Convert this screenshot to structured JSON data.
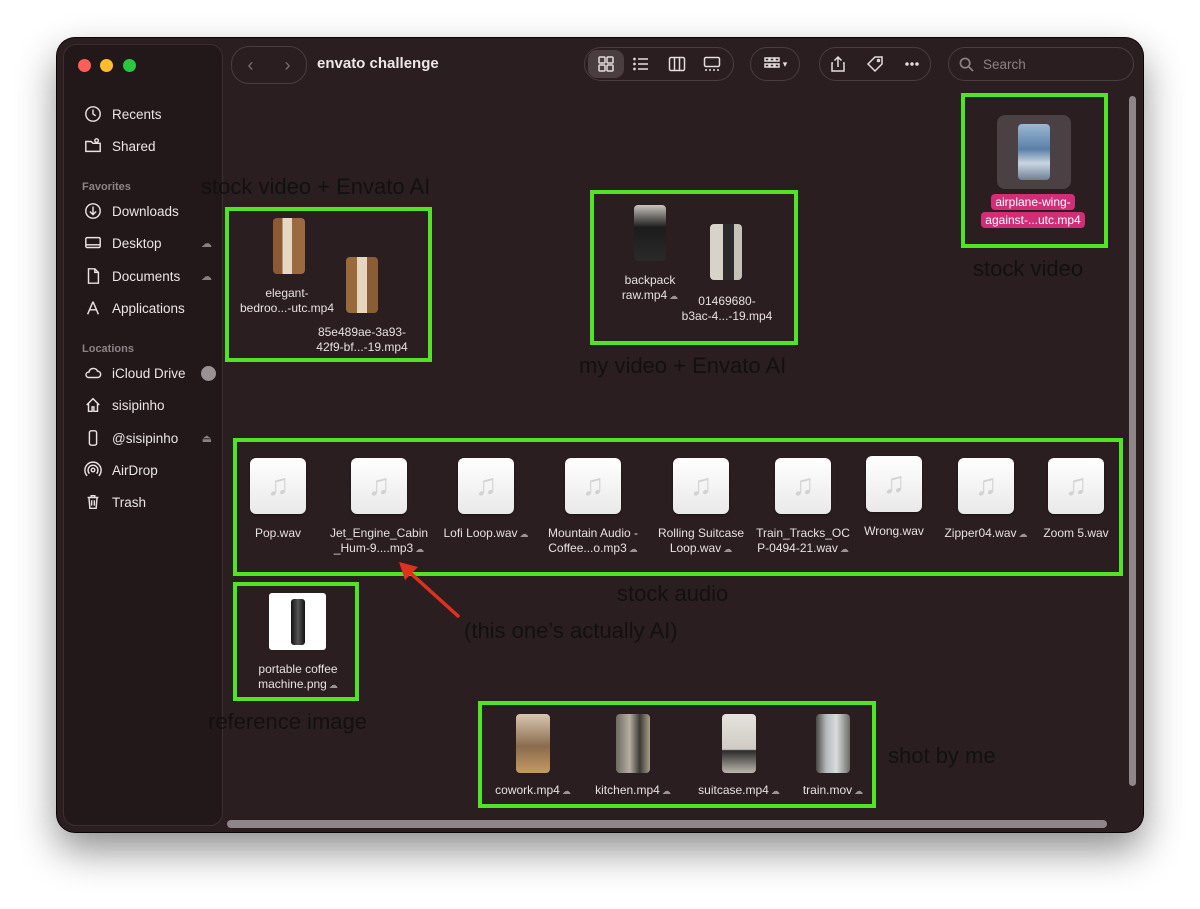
{
  "window": {
    "title": "envato challenge"
  },
  "sidebar": {
    "items_top": [
      {
        "label": "Recents",
        "icon": "clock-icon"
      },
      {
        "label": "Shared",
        "icon": "shared-folder-icon"
      }
    ],
    "favorites_header": "Favorites",
    "favorites": [
      {
        "label": "Downloads",
        "icon": "download-icon"
      },
      {
        "label": "Desktop",
        "icon": "desktop-icon"
      },
      {
        "label": "Documents",
        "icon": "document-icon"
      },
      {
        "label": "Applications",
        "icon": "applications-icon"
      }
    ],
    "locations_header": "Locations",
    "locations": [
      {
        "label": "iCloud Drive",
        "icon": "cloud-icon"
      },
      {
        "label": "sisipinho",
        "icon": "home-icon"
      },
      {
        "label": "@sisipinho",
        "icon": "phone-icon"
      },
      {
        "label": "AirDrop",
        "icon": "airdrop-icon"
      },
      {
        "label": "Trash",
        "icon": "trash-icon"
      }
    ]
  },
  "toolbar": {
    "search_placeholder": "Search"
  },
  "files": {
    "stock_ai": [
      {
        "name_line1": "elegant-",
        "name_line2": "bedroo...-utc.mp4"
      },
      {
        "name_line1": "85e489ae-3a93-",
        "name_line2": "42f9-bf...-19.mp4"
      }
    ],
    "my_ai": [
      {
        "name_line1": "backpack",
        "name_line2": "raw.mp4"
      },
      {
        "name_line1": "01469680-",
        "name_line2": "b3ac-4...-19.mp4"
      }
    ],
    "stock_video": {
      "name_line1": "airplane-wing-",
      "name_line2": "against-...utc.mp4"
    },
    "audio": [
      {
        "line1": "Pop.wav",
        "line2": ""
      },
      {
        "line1": "Jet_Engine_Cabin",
        "line2": "_Hum-9....mp3"
      },
      {
        "line1": "Lofi Loop.wav",
        "line2": ""
      },
      {
        "line1": "Mountain Audio -",
        "line2": "Coffee...o.mp3"
      },
      {
        "line1": "Rolling Suitcase",
        "line2": "Loop.wav"
      },
      {
        "line1": "Train_Tracks_OC",
        "line2": "P-0494-21.wav"
      },
      {
        "line1": "Wrong.wav",
        "line2": ""
      },
      {
        "line1": "Zipper04.wav",
        "line2": ""
      },
      {
        "line1": "Zoom 5.wav",
        "line2": ""
      }
    ],
    "reference": {
      "name_line1": "portable coffee",
      "name_line2": "machine.png"
    },
    "shot": [
      {
        "name": "cowork.mp4"
      },
      {
        "name": "kitchen.mp4"
      },
      {
        "name": "suitcase.mp4"
      },
      {
        "name": "train.mov"
      }
    ]
  },
  "annotations": {
    "stock_ai": "stock video + Envato AI",
    "my_ai": "my video + Envato AI",
    "stock_video": "stock video",
    "stock_audio": "stock audio",
    "actually_ai": "(this one’s actually AI)",
    "reference": "reference image",
    "shot": "shot by me"
  },
  "colors": {
    "highlight_box": "#52e325",
    "selection": "#d22e78",
    "arrow": "#e0311f"
  }
}
